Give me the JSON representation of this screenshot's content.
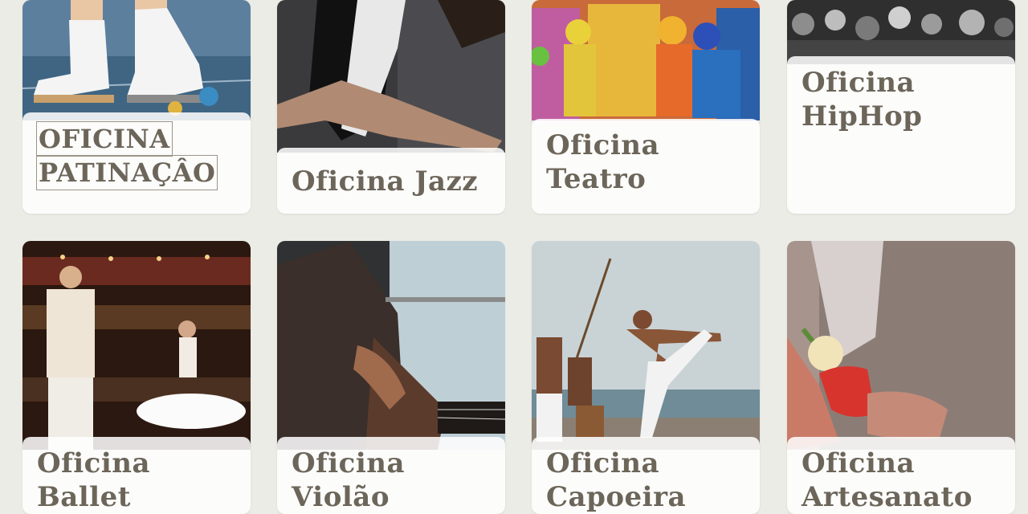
{
  "cards": [
    {
      "title": "OFICINA PATINAÇÂO",
      "lines": [
        "OFICINA",
        "PATINAÇÂO"
      ],
      "photo": "roller-skates-photo"
    },
    {
      "title": "Oficina Jazz",
      "lines": [
        "Oficina Jazz"
      ],
      "photo": "jazz-dancer-photo"
    },
    {
      "title": "Oficina Teatro",
      "lines": [
        "Oficina",
        "Teatro"
      ],
      "photo": "theater-clowns-photo"
    },
    {
      "title": "Oficina HipHop",
      "lines": [
        "Oficina",
        "HipHop"
      ],
      "photo": "hiphop-crowd-photo"
    },
    {
      "title": "Oficina Ballet",
      "lines": [
        "Oficina",
        "Ballet"
      ],
      "photo": "ballet-dancers-photo"
    },
    {
      "title": "Oficina Violão",
      "lines": [
        "Oficina",
        "Violão"
      ],
      "photo": "guitar-player-photo"
    },
    {
      "title": "Oficina Capoeira",
      "lines": [
        "Oficina",
        "Capoeira"
      ],
      "photo": "capoeira-beach-photo"
    },
    {
      "title": "Oficina Artesanato",
      "lines": [
        "Oficina",
        "Artesanato"
      ],
      "photo": "handcraft-photo"
    }
  ],
  "colors": {
    "background": "#ecece6",
    "label_text": "#6c6559",
    "label_bg": "#ffffff"
  }
}
